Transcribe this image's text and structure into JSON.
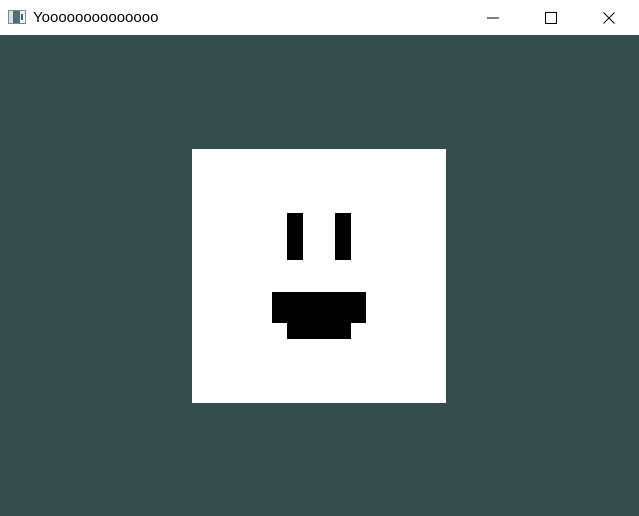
{
  "window": {
    "title": "Yoooooooooooooo",
    "icons": {
      "app": "application-icon",
      "minimize": "minimize-icon",
      "maximize": "maximize-icon",
      "close": "close-icon"
    }
  },
  "canvas": {
    "background_color": "#334d4d",
    "square_color": "#ffffff",
    "feature_color": "#000000"
  }
}
